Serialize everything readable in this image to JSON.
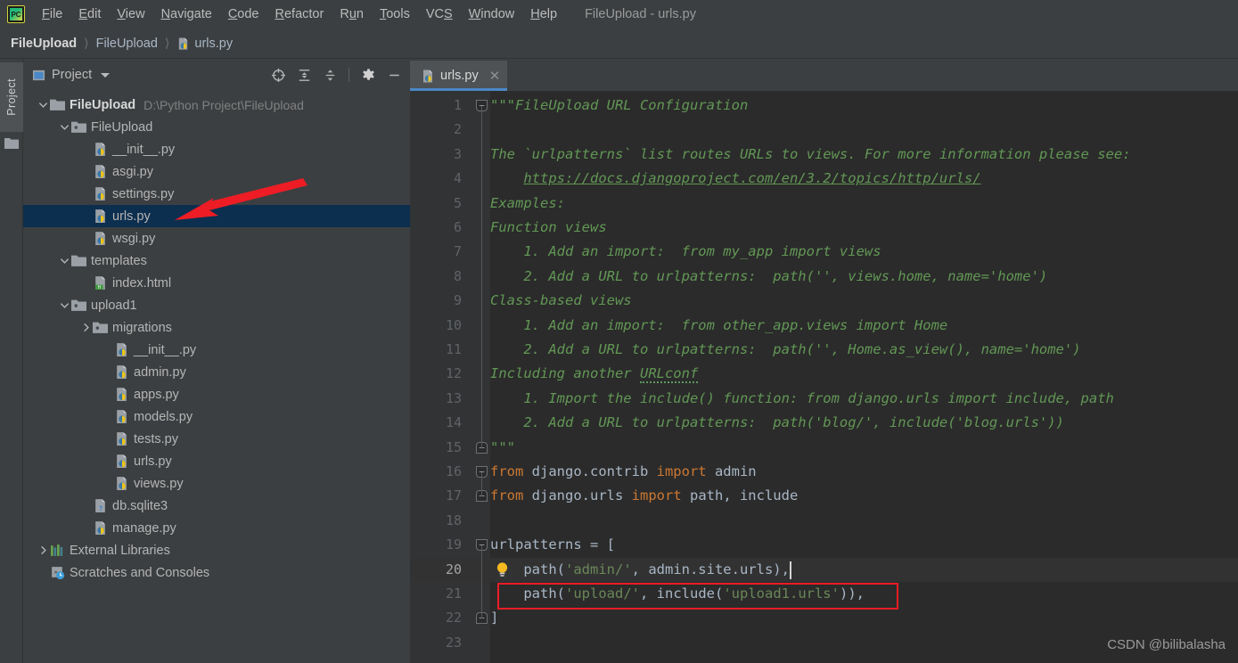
{
  "window": {
    "title": "FileUpload - urls.py",
    "app_icon": "pycharm-logo-icon"
  },
  "menubar": {
    "items": [
      {
        "label": "File",
        "mnemonic": "F"
      },
      {
        "label": "Edit",
        "mnemonic": "E"
      },
      {
        "label": "View",
        "mnemonic": "V"
      },
      {
        "label": "Navigate",
        "mnemonic": "N"
      },
      {
        "label": "Code",
        "mnemonic": "C"
      },
      {
        "label": "Refactor",
        "mnemonic": "R"
      },
      {
        "label": "Run",
        "mnemonic": "u"
      },
      {
        "label": "Tools",
        "mnemonic": "T"
      },
      {
        "label": "VCS",
        "mnemonic": "S"
      },
      {
        "label": "Window",
        "mnemonic": "W"
      },
      {
        "label": "Help",
        "mnemonic": "H"
      }
    ]
  },
  "breadcrumb": {
    "items": [
      "FileUpload",
      "FileUpload",
      "urls.py"
    ],
    "separator": "〉",
    "file_icon": "python-file-icon"
  },
  "tool_stripe": {
    "project_tab_label": "Project",
    "folder_icon": "folder-icon"
  },
  "project_panel": {
    "title": "Project",
    "view_icon": "project-view-icon",
    "caret_icon": "chevron-down-icon",
    "tools": [
      {
        "name": "locate-icon",
        "glyph": "target"
      },
      {
        "name": "expand-all-icon",
        "glyph": "expand"
      },
      {
        "name": "collapse-all-icon",
        "glyph": "collapse"
      },
      {
        "name": "settings-gear-icon",
        "glyph": "gear"
      },
      {
        "name": "hide-panel-icon",
        "glyph": "minus"
      }
    ],
    "tree": [
      {
        "label": "FileUpload",
        "path": "D:\\Python Project\\FileUpload",
        "icon": "folder-icon",
        "indent": 0,
        "twisty": "down",
        "bold": true,
        "selected": false
      },
      {
        "label": "FileUpload",
        "path": "",
        "icon": "module-folder-icon",
        "indent": 1,
        "twisty": "down",
        "bold": false,
        "selected": false
      },
      {
        "label": "__init__.py",
        "path": "",
        "icon": "python-file-icon",
        "indent": 2,
        "twisty": "",
        "bold": false,
        "selected": false
      },
      {
        "label": "asgi.py",
        "path": "",
        "icon": "python-file-icon",
        "indent": 2,
        "twisty": "",
        "bold": false,
        "selected": false
      },
      {
        "label": "settings.py",
        "path": "",
        "icon": "python-file-icon",
        "indent": 2,
        "twisty": "",
        "bold": false,
        "selected": false
      },
      {
        "label": "urls.py",
        "path": "",
        "icon": "python-file-icon",
        "indent": 2,
        "twisty": "",
        "bold": false,
        "selected": true
      },
      {
        "label": "wsgi.py",
        "path": "",
        "icon": "python-file-icon",
        "indent": 2,
        "twisty": "",
        "bold": false,
        "selected": false
      },
      {
        "label": "templates",
        "path": "",
        "icon": "folder-icon",
        "indent": 1,
        "twisty": "down",
        "bold": false,
        "selected": false
      },
      {
        "label": "index.html",
        "path": "",
        "icon": "html-file-icon",
        "indent": 2,
        "twisty": "",
        "bold": false,
        "selected": false
      },
      {
        "label": "upload1",
        "path": "",
        "icon": "module-folder-icon",
        "indent": 1,
        "twisty": "down",
        "bold": false,
        "selected": false
      },
      {
        "label": "migrations",
        "path": "",
        "icon": "module-folder-icon",
        "indent": 2,
        "twisty": "right",
        "bold": false,
        "selected": false
      },
      {
        "label": "__init__.py",
        "path": "",
        "icon": "python-file-icon",
        "indent": 3,
        "twisty": "",
        "bold": false,
        "selected": false
      },
      {
        "label": "admin.py",
        "path": "",
        "icon": "python-file-icon",
        "indent": 3,
        "twisty": "",
        "bold": false,
        "selected": false
      },
      {
        "label": "apps.py",
        "path": "",
        "icon": "python-file-icon",
        "indent": 3,
        "twisty": "",
        "bold": false,
        "selected": false
      },
      {
        "label": "models.py",
        "path": "",
        "icon": "python-file-icon",
        "indent": 3,
        "twisty": "",
        "bold": false,
        "selected": false
      },
      {
        "label": "tests.py",
        "path": "",
        "icon": "python-file-icon",
        "indent": 3,
        "twisty": "",
        "bold": false,
        "selected": false
      },
      {
        "label": "urls.py",
        "path": "",
        "icon": "python-file-icon",
        "indent": 3,
        "twisty": "",
        "bold": false,
        "selected": false
      },
      {
        "label": "views.py",
        "path": "",
        "icon": "python-file-icon",
        "indent": 3,
        "twisty": "",
        "bold": false,
        "selected": false
      },
      {
        "label": "db.sqlite3",
        "path": "",
        "icon": "unknown-file-icon",
        "indent": 2,
        "twisty": "",
        "bold": false,
        "selected": false
      },
      {
        "label": "manage.py",
        "path": "",
        "icon": "python-file-icon",
        "indent": 2,
        "twisty": "",
        "bold": false,
        "selected": false
      },
      {
        "label": "External Libraries",
        "path": "",
        "icon": "libraries-icon",
        "indent": 0,
        "twisty": "right",
        "bold": false,
        "selected": false
      },
      {
        "label": "Scratches and Consoles",
        "path": "",
        "icon": "scratches-icon",
        "indent": 0,
        "twisty": "",
        "bold": false,
        "selected": false
      }
    ]
  },
  "editor": {
    "tab": {
      "label": "urls.py",
      "icon": "python-file-icon",
      "close_icon": "close-icon",
      "active": true
    },
    "current_line": 20,
    "lines": [
      {
        "n": 1,
        "fold": "start",
        "segs": [
          {
            "t": "\"\"\"FileUpload URL Configuration",
            "c": "doc"
          }
        ]
      },
      {
        "n": 2,
        "fold": "",
        "segs": []
      },
      {
        "n": 3,
        "fold": "",
        "segs": [
          {
            "t": "The `urlpatterns` list routes URLs to views. For more information please see:",
            "c": "doc"
          }
        ]
      },
      {
        "n": 4,
        "fold": "",
        "segs": [
          {
            "t": "    ",
            "c": "doc"
          },
          {
            "t": "https://docs.djangoproject.com/en/3.2/topics/http/urls/",
            "c": "doc-link"
          }
        ]
      },
      {
        "n": 5,
        "fold": "",
        "segs": [
          {
            "t": "Examples:",
            "c": "doc"
          }
        ]
      },
      {
        "n": 6,
        "fold": "",
        "segs": [
          {
            "t": "Function views",
            "c": "doc"
          }
        ]
      },
      {
        "n": 7,
        "fold": "",
        "segs": [
          {
            "t": "    1. Add an import:  from my_app import views",
            "c": "doc"
          }
        ]
      },
      {
        "n": 8,
        "fold": "",
        "segs": [
          {
            "t": "    2. Add a URL to urlpatterns:  path('', views.home, name='home')",
            "c": "doc"
          }
        ]
      },
      {
        "n": 9,
        "fold": "",
        "segs": [
          {
            "t": "Class-based views",
            "c": "doc"
          }
        ]
      },
      {
        "n": 10,
        "fold": "",
        "segs": [
          {
            "t": "    1. Add an import:  from other_app.views import Home",
            "c": "doc"
          }
        ]
      },
      {
        "n": 11,
        "fold": "",
        "segs": [
          {
            "t": "    2. Add a URL to urlpatterns:  path('', Home.as_view(), name='home')",
            "c": "doc"
          }
        ]
      },
      {
        "n": 12,
        "fold": "",
        "segs": [
          {
            "t": "Including another ",
            "c": "doc"
          },
          {
            "t": "URLconf",
            "c": "doc-spell"
          }
        ]
      },
      {
        "n": 13,
        "fold": "",
        "segs": [
          {
            "t": "    1. Import the include() function: from django.urls import include, path",
            "c": "doc"
          }
        ]
      },
      {
        "n": 14,
        "fold": "",
        "segs": [
          {
            "t": "    2. Add a URL to urlpatterns:  path('blog/', include('blog.urls'))",
            "c": "doc"
          }
        ]
      },
      {
        "n": 15,
        "fold": "end",
        "segs": [
          {
            "t": "\"\"\"",
            "c": "doc"
          }
        ]
      },
      {
        "n": 16,
        "fold": "start",
        "segs": [
          {
            "t": "from",
            "c": "kw"
          },
          {
            "t": " django.contrib ",
            "c": "plain"
          },
          {
            "t": "import",
            "c": "kw"
          },
          {
            "t": " admin",
            "c": "plain"
          }
        ]
      },
      {
        "n": 17,
        "fold": "end",
        "segs": [
          {
            "t": "from",
            "c": "kw"
          },
          {
            "t": " django.urls ",
            "c": "plain"
          },
          {
            "t": "import",
            "c": "kw"
          },
          {
            "t": " path, include",
            "c": "plain"
          }
        ]
      },
      {
        "n": 18,
        "fold": "",
        "segs": []
      },
      {
        "n": 19,
        "fold": "start",
        "segs": [
          {
            "t": "urlpatterns = [",
            "c": "plain"
          }
        ]
      },
      {
        "n": 20,
        "fold": "",
        "segs": [
          {
            "t": "    path(",
            "c": "plain"
          },
          {
            "t": "'admin/'",
            "c": "str"
          },
          {
            "t": ", admin.site.urls),",
            "c": "plain"
          }
        ],
        "bulb": true,
        "caret": true
      },
      {
        "n": 21,
        "fold": "",
        "segs": [
          {
            "t": "    path(",
            "c": "plain"
          },
          {
            "t": "'upload/'",
            "c": "str"
          },
          {
            "t": ", include(",
            "c": "plain"
          },
          {
            "t": "'upload1.urls'",
            "c": "str"
          },
          {
            "t": ")),",
            "c": "plain"
          }
        ],
        "boxed": true
      },
      {
        "n": 22,
        "fold": "end",
        "segs": [
          {
            "t": "]",
            "c": "plain"
          }
        ]
      },
      {
        "n": 23,
        "fold": "",
        "segs": []
      }
    ]
  },
  "annotations": {
    "red_arrow": {
      "name": "red-arrow-annotation",
      "color": "#ee1c25"
    },
    "red_box": {
      "name": "red-highlight-box",
      "color": "#ee1c25",
      "target_line": 21
    }
  },
  "watermark": {
    "text": "CSDN @bilibalasha"
  },
  "colors": {
    "chrome": "#3c3f41",
    "editor_bg": "#2b2b2b",
    "gutter_bg": "#313335",
    "selection": "#0d2f4f",
    "tab_active_underline": "#4a88c7",
    "keyword": "#cc7832",
    "string": "#6a8759",
    "docstring": "#629755",
    "text": "#a9b7c6",
    "annotation_red": "#ee1c25"
  }
}
